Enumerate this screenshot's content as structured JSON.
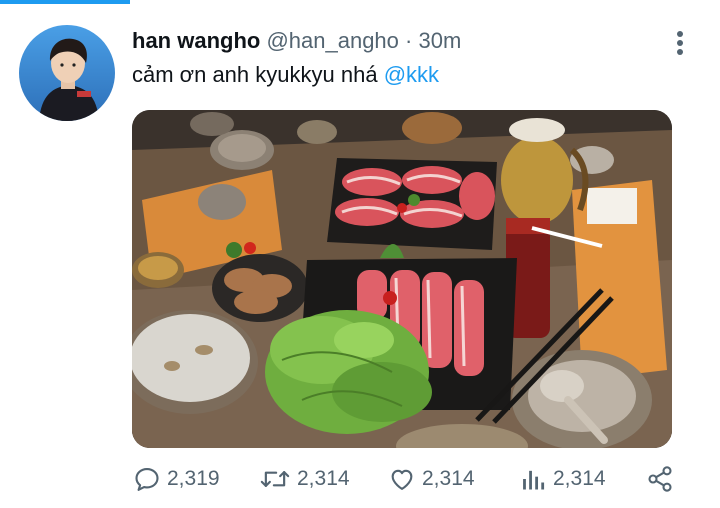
{
  "tweet": {
    "display_name": "han wangho",
    "handle": "@han_angho",
    "separator": "·",
    "time": "30m",
    "text": "cảm ơn anh kyukkyu nhá",
    "mention": "@kkk"
  },
  "stats": {
    "replies": "2,319",
    "retweets": "2,314",
    "likes": "2,314",
    "views": "2,314"
  },
  "icons": {
    "more": "more-vertical-icon",
    "reply": "reply-icon",
    "retweet": "retweet-icon",
    "like": "heart-icon",
    "views": "analytics-icon",
    "share": "share-icon"
  },
  "colors": {
    "accent": "#1d9bf0",
    "text": "#0f1419",
    "muted": "#536471"
  }
}
